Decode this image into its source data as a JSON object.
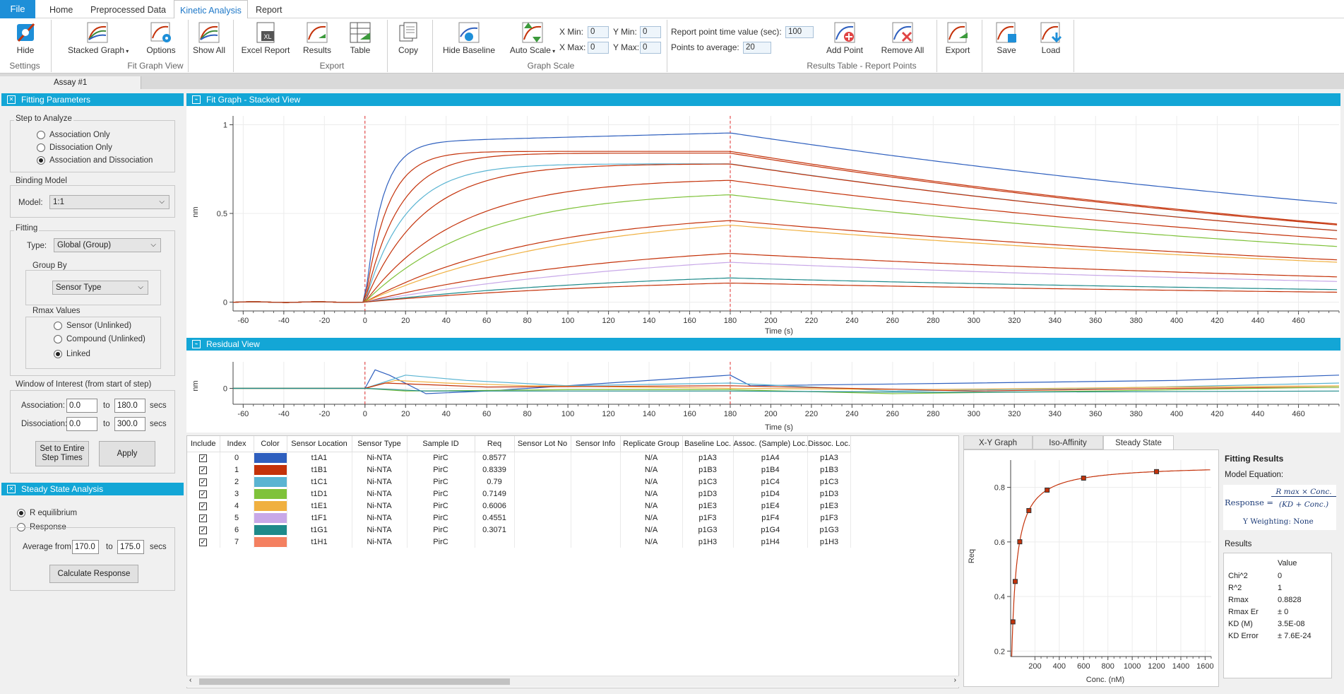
{
  "menu": {
    "file": "File",
    "tabs": [
      "Home",
      "Preprocessed Data",
      "Kinetic Analysis",
      "Report"
    ],
    "active": "Kinetic Analysis"
  },
  "ribbon": {
    "buttons": {
      "hide": "Hide",
      "stacked_graph": "Stacked Graph",
      "options": "Options",
      "show_all": "Show All",
      "excel_report": "Excel Report",
      "results": "Results",
      "table": "Table",
      "copy": "Copy",
      "hide_baseline": "Hide Baseline",
      "auto_scale": "Auto Scale",
      "add_point": "Add Point",
      "remove_all": "Remove All",
      "export": "Export",
      "save": "Save",
      "load": "Load"
    },
    "groups": {
      "settings": "Settings",
      "fit_graph_view": "Fit Graph View",
      "export": "Export",
      "graph_scale": "Graph Scale",
      "results_table": "Results Table - Report Points"
    },
    "scale": {
      "xmin_label": "X Min:",
      "xmin": "0",
      "xmax_label": "X Max:",
      "xmax": "0",
      "ymin_label": "Y Min:",
      "ymin": "0",
      "ymax_label": "Y Max:",
      "ymax": "0"
    },
    "report": {
      "time_label": "Report point time value (sec):",
      "time": "100",
      "avg_label": "Points to average:",
      "avg": "20"
    }
  },
  "doc_tab": "Assay #1",
  "fitting": {
    "header": "Fitting Parameters",
    "step_legend": "Step to Analyze",
    "steps": [
      "Association Only",
      "Dissociation Only",
      "Association and Dissociation"
    ],
    "step_selected": 2,
    "binding_legend": "Binding Model",
    "model_label": "Model:",
    "model": "1:1",
    "fitting_legend": "Fitting",
    "type_label": "Type:",
    "type": "Global (Group)",
    "group_by_legend": "Group By",
    "group_by": "Sensor Type",
    "rmax_legend": "Rmax Values",
    "rmax_options": [
      "Sensor (Unlinked)",
      "Compound (Unlinked)",
      "Linked"
    ],
    "rmax_selected": 2,
    "woi_legend": "Window of Interest (from start of step)",
    "assoc_label": "Association:",
    "assoc_from": "0.0",
    "assoc_to": "180.0",
    "dissoc_label": "Dissociation:",
    "dissoc_from": "0.0",
    "dissoc_to": "300.0",
    "to": "to",
    "secs": "secs",
    "set_entire": "Set to Entire Step Times",
    "apply": "Apply"
  },
  "steady_state": {
    "header": "Steady State Analysis",
    "options": [
      "R equilibrium",
      "Response"
    ],
    "selected": 0,
    "avg_label": "Average from",
    "avg_from": "170.0",
    "to": "to",
    "avg_to": "175.0",
    "secs": "secs",
    "calculate": "Calculate Response"
  },
  "fit_graph": {
    "header": "Fit Graph - Stacked View",
    "ylabel": "nm",
    "xlabel": "Time (s)"
  },
  "residual": {
    "header": "Residual View",
    "ylabel": "nm",
    "xlabel": "Time (s)"
  },
  "results_table": {
    "columns": [
      "Include",
      "Index",
      "Color",
      "Sensor Location",
      "Sensor Type",
      "Sample ID",
      "Req",
      "Sensor Lot No",
      "Sensor Info",
      "Replicate Group",
      "Baseline Loc.",
      "Assoc. (Sample) Loc.",
      "Dissoc. Loc."
    ],
    "rows": [
      {
        "index": "0",
        "color": "#2e5fbe",
        "loc": "t1A1",
        "type": "Ni-NTA",
        "sample": "PirC",
        "req": "0.8577",
        "rep": "N/A",
        "base": "p1A3",
        "assoc": "p1A4",
        "dissoc": "p1A3"
      },
      {
        "index": "1",
        "color": "#c4320a",
        "loc": "t1B1",
        "type": "Ni-NTA",
        "sample": "PirC",
        "req": "0.8339",
        "rep": "N/A",
        "base": "p1B3",
        "assoc": "p1B4",
        "dissoc": "p1B3"
      },
      {
        "index": "2",
        "color": "#5ab4d2",
        "loc": "t1C1",
        "type": "Ni-NTA",
        "sample": "PirC",
        "req": "0.79",
        "rep": "N/A",
        "base": "p1C3",
        "assoc": "p1C4",
        "dissoc": "p1C3"
      },
      {
        "index": "3",
        "color": "#7fc23a",
        "loc": "t1D1",
        "type": "Ni-NTA",
        "sample": "PirC",
        "req": "0.7149",
        "rep": "N/A",
        "base": "p1D3",
        "assoc": "p1D4",
        "dissoc": "p1D3"
      },
      {
        "index": "4",
        "color": "#f0b040",
        "loc": "t1E1",
        "type": "Ni-NTA",
        "sample": "PirC",
        "req": "0.6006",
        "rep": "N/A",
        "base": "p1E3",
        "assoc": "p1E4",
        "dissoc": "p1E3"
      },
      {
        "index": "5",
        "color": "#c8a8e8",
        "loc": "t1F1",
        "type": "Ni-NTA",
        "sample": "PirC",
        "req": "0.4551",
        "rep": "N/A",
        "base": "p1F3",
        "assoc": "p1F4",
        "dissoc": "p1F3"
      },
      {
        "index": "6",
        "color": "#1e8a8a",
        "loc": "t1G1",
        "type": "Ni-NTA",
        "sample": "PirC",
        "req": "0.3071",
        "rep": "N/A",
        "base": "p1G3",
        "assoc": "p1G4",
        "dissoc": "p1G3"
      },
      {
        "index": "7",
        "color": "#f48060",
        "loc": "t1H1",
        "type": "Ni-NTA",
        "sample": "PirC",
        "req": "",
        "rep": "N/A",
        "base": "p1H3",
        "assoc": "p1H4",
        "dissoc": "p1H3"
      }
    ]
  },
  "tabs_right": [
    "X-Y Graph",
    "Iso-Affinity",
    "Steady State"
  ],
  "tabs_right_active": 2,
  "steady_plot": {
    "ylabel": "Req",
    "xlabel": "Conc. (nM)"
  },
  "fitting_results": {
    "title": "Fitting Results",
    "model_eq_label": "Model Equation:",
    "eq_lhs": "Response =",
    "eq_num": "R max × Conc.",
    "eq_den": "(KD + Conc.)",
    "weighting": "Y Weighting: None",
    "results_label": "Results",
    "value_header": "Value",
    "rows": [
      {
        "name": "Chi^2",
        "value": "0"
      },
      {
        "name": "R^2",
        "value": "1"
      },
      {
        "name": "Rmax",
        "value": "0.8828"
      },
      {
        "name": "Rmax Er",
        "value": "± 0"
      },
      {
        "name": "KD (M)",
        "value": "3.5E-08"
      },
      {
        "name": "KD Error",
        "value": "± 7.6E-24"
      }
    ]
  },
  "chart_data": [
    {
      "type": "line",
      "xlabel": "Time (s)",
      "ylabel": "nm",
      "xlim": [
        -65,
        480
      ],
      "ylim": [
        -0.05,
        1.05
      ],
      "xticks": [
        -60,
        -40,
        -20,
        0,
        20,
        40,
        60,
        80,
        100,
        120,
        140,
        160,
        180,
        200,
        220,
        240,
        260,
        280,
        300,
        320,
        340,
        360,
        380,
        400,
        420,
        440,
        460
      ],
      "yticks": [
        0,
        0.5,
        1
      ],
      "yticklabels": [
        "0",
        "0.5",
        "1"
      ],
      "markers_x": [
        0,
        180
      ],
      "series": [
        {
          "color": "#2e5fbe",
          "kobs": 0.12,
          "req": 0.9,
          "drift": 0.0003,
          "kd": 0.0018
        },
        {
          "color": "#c4320a",
          "kobs": 0.09,
          "req": 0.85,
          "drift": 0.0,
          "kd": 0.0022
        },
        {
          "color": "#c4320a",
          "kobs": 0.06,
          "req": 0.84,
          "drift": 0.0,
          "kd": 0.0022
        },
        {
          "color": "#5ab4d2",
          "kobs": 0.05,
          "req": 0.78,
          "drift": 0.0,
          "kd": 0.0022
        },
        {
          "color": "#c4320a",
          "kobs": 0.035,
          "req": 0.78,
          "drift": 0.0,
          "kd": 0.0022
        },
        {
          "color": "#c4320a",
          "kobs": 0.022,
          "req": 0.7,
          "drift": 0.0,
          "kd": 0.0022
        },
        {
          "color": "#7fc23a",
          "kobs": 0.018,
          "req": 0.63,
          "drift": 0.0,
          "kd": 0.0022
        },
        {
          "color": "#c4320a",
          "kobs": 0.012,
          "req": 0.52,
          "drift": 0.0,
          "kd": 0.0022
        },
        {
          "color": "#f0b040",
          "kobs": 0.01,
          "req": 0.52,
          "drift": 0.0,
          "kd": 0.0022
        },
        {
          "color": "#c4320a",
          "kobs": 0.008,
          "req": 0.36,
          "drift": 0.0,
          "kd": 0.0022
        },
        {
          "color": "#c8a8e8",
          "kobs": 0.006,
          "req": 0.34,
          "drift": 0.0,
          "kd": 0.0022
        },
        {
          "color": "#1e8a8a",
          "kobs": 0.007,
          "req": 0.19,
          "drift": 0.0,
          "kd": 0.0022
        },
        {
          "color": "#c4320a",
          "kobs": 0.007,
          "req": 0.15,
          "drift": 0.0,
          "kd": 0.0022
        }
      ]
    },
    {
      "type": "line",
      "xlabel": "Time (s)",
      "ylabel": "nm",
      "xlim": [
        -65,
        480
      ],
      "ylim": [
        -0.06,
        0.1
      ],
      "yticks": [
        0
      ],
      "yticklabels": [
        "0"
      ],
      "xticks": [
        -60,
        -40,
        -20,
        0,
        20,
        40,
        60,
        80,
        100,
        120,
        140,
        160,
        180,
        200,
        220,
        240,
        260,
        280,
        300,
        320,
        340,
        360,
        380,
        400,
        420,
        440,
        460
      ],
      "series": [
        {
          "color": "#2e5fbe",
          "points": [
            [
              -65,
              0
            ],
            [
              0,
              0
            ],
            [
              5,
              0.07
            ],
            [
              12,
              0.05
            ],
            [
              30,
              -0.02
            ],
            [
              60,
              -0.01
            ],
            [
              120,
              0.02
            ],
            [
              180,
              0.05
            ],
            [
              190,
              0.01
            ],
            [
              300,
              0.02
            ],
            [
              400,
              0.03
            ],
            [
              480,
              0.05
            ]
          ]
        },
        {
          "color": "#5ab4d2",
          "points": [
            [
              -65,
              0
            ],
            [
              0,
              0
            ],
            [
              20,
              0.05
            ],
            [
              50,
              0.03
            ],
            [
              100,
              0.01
            ],
            [
              180,
              0.02
            ],
            [
              260,
              -0.01
            ],
            [
              360,
              0.0
            ],
            [
              480,
              0.02
            ]
          ]
        },
        {
          "color": "#f0b040",
          "points": [
            [
              -65,
              0
            ],
            [
              0,
              0
            ],
            [
              15,
              0.03
            ],
            [
              40,
              0.02
            ],
            [
              80,
              0.01
            ],
            [
              180,
              0.0
            ],
            [
              280,
              -0.005
            ],
            [
              400,
              0.005
            ],
            [
              480,
              0.01
            ]
          ]
        },
        {
          "color": "#c4320a",
          "points": [
            [
              -65,
              0
            ],
            [
              0,
              0
            ],
            [
              10,
              0.02
            ],
            [
              60,
              0.005
            ],
            [
              180,
              0.01
            ],
            [
              300,
              -0.01
            ],
            [
              400,
              0.0
            ],
            [
              480,
              0.005
            ]
          ]
        },
        {
          "color": "#7fc23a",
          "points": [
            [
              -65,
              0
            ],
            [
              0,
              0
            ],
            [
              20,
              -0.01
            ],
            [
              100,
              -0.005
            ],
            [
              180,
              -0.005
            ],
            [
              260,
              -0.02
            ],
            [
              360,
              -0.01
            ],
            [
              480,
              0.005
            ]
          ]
        },
        {
          "color": "#1e8a8a",
          "points": [
            [
              -65,
              0
            ],
            [
              0,
              0
            ],
            [
              30,
              -0.01
            ],
            [
              180,
              -0.01
            ],
            [
              280,
              -0.015
            ],
            [
              480,
              -0.01
            ]
          ]
        }
      ]
    },
    {
      "type": "scatter",
      "xlabel": "Conc. (nM)",
      "ylabel": "Req",
      "xlim": [
        0,
        1650
      ],
      "ylim": [
        0.18,
        0.9
      ],
      "xticks": [
        200,
        400,
        600,
        800,
        1000,
        1200,
        1400,
        1600
      ],
      "yticks": [
        0.2,
        0.4,
        0.6,
        0.8
      ],
      "yticklabels": [
        "0.2",
        "0.4",
        "0.6",
        "0.8"
      ],
      "fit": {
        "rmax": 0.8828,
        "kd_nM": 35
      },
      "x": [
        18.75,
        37.5,
        75,
        150,
        300,
        600,
        1200
      ],
      "y": [
        0.3071,
        0.4551,
        0.6006,
        0.7149,
        0.79,
        0.8339,
        0.8577
      ]
    }
  ]
}
